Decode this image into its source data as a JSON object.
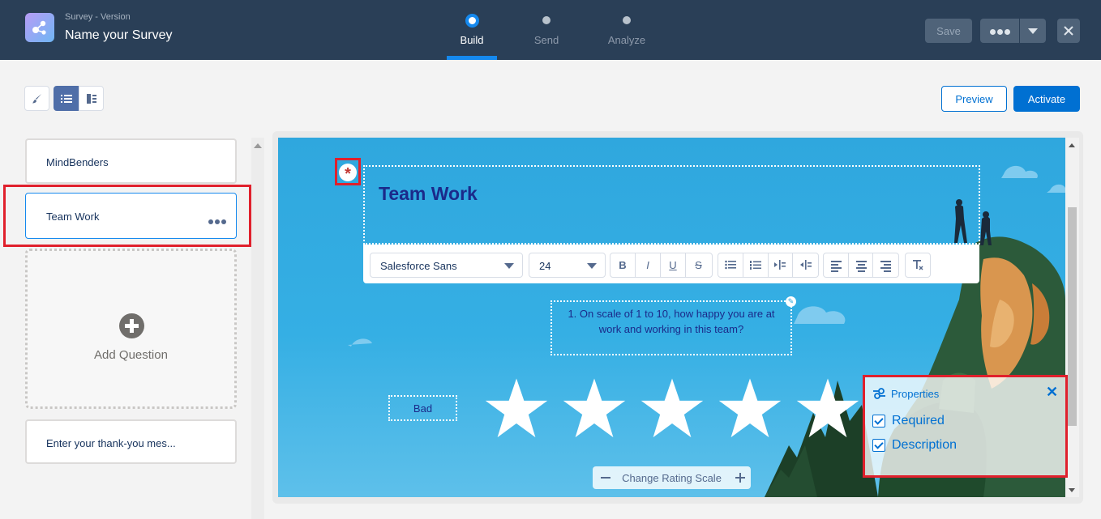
{
  "header": {
    "subtitle": "Survey - Version",
    "title": "Name your Survey",
    "steps": [
      {
        "label": "Build",
        "active": true
      },
      {
        "label": "Send",
        "active": false
      },
      {
        "label": "Analyze",
        "active": false
      }
    ],
    "save_label": "Save",
    "more_icon": "ellipsis-icon",
    "close_icon": "close-icon",
    "accent_color": "#1589ee",
    "bar_color": "#2a3f57"
  },
  "toolbar": {
    "preview_label": "Preview",
    "activate_label": "Activate",
    "view_icons": [
      "paintbrush-icon",
      "list-icon",
      "split-view-icon"
    ]
  },
  "sidebar": {
    "pages": [
      {
        "label": "MindBenders"
      },
      {
        "label": "Team Work",
        "selected": true
      },
      {
        "label": "Enter your thank-you mes..."
      }
    ],
    "add_question_label": "Add Question"
  },
  "canvas": {
    "page_title": "Team Work",
    "required_marker": "*",
    "font_family_value": "Salesforce Sans",
    "font_size_value": "24",
    "format_buttons": [
      "B",
      "I",
      "U",
      "S"
    ],
    "question_text": "1. On scale of 1 to 10, how happy you are at work and working in this team?",
    "low_label": "Bad",
    "rating_max": 5,
    "change_scale_label": "Change Rating Scale"
  },
  "properties": {
    "title": "Properties",
    "items": [
      {
        "label": "Required",
        "checked": true
      },
      {
        "label": "Description",
        "checked": true
      }
    ]
  }
}
